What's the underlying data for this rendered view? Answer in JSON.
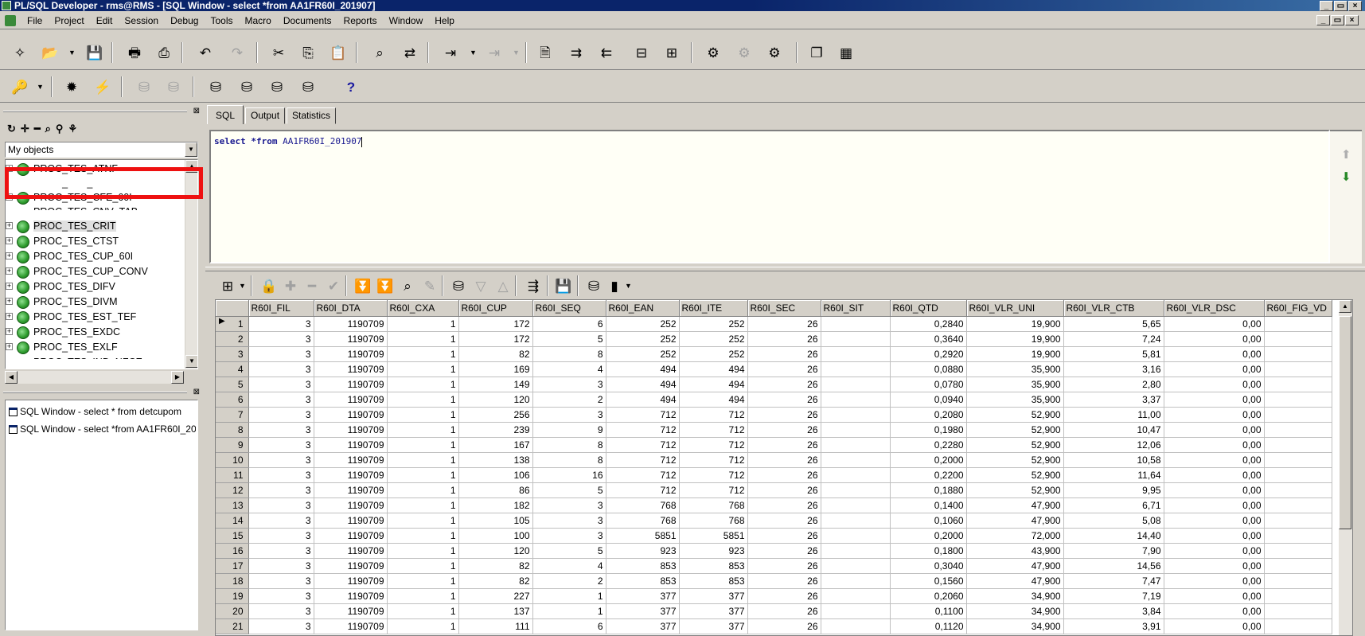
{
  "window": {
    "title": "PL/SQL Developer - rms@RMS - [SQL Window - select *from AA1FR60I_201907]",
    "controls": [
      "_",
      "▭",
      "×"
    ]
  },
  "menu": [
    "File",
    "Project",
    "Edit",
    "Session",
    "Debug",
    "Tools",
    "Macro",
    "Documents",
    "Reports",
    "Window",
    "Help"
  ],
  "toolbar_icons": [
    "new-icon",
    "open-icon",
    "save-icon",
    "print-icon",
    "print-preview-icon",
    "undo-icon",
    "redo-icon",
    "cut-icon",
    "copy-icon",
    "paste-icon",
    "find-icon",
    "find-replace-icon",
    "execute-icon",
    "break-icon",
    "describe-icon",
    "indent-icon",
    "unindent-icon",
    "comment-icon",
    "uncomment-icon",
    "compile-icon",
    "compile-dim-icon",
    "compile-all-icon",
    "window-list-icon",
    "layout-icon"
  ],
  "toolbar2_icons": [
    "key-icon",
    "gear-icon",
    "bolt-icon",
    "db-commit-icon",
    "db-rollback-icon",
    "user-icon",
    "csv-icon",
    "export-icon",
    "import-icon",
    "help-icon"
  ],
  "browser": {
    "selector_value": "My objects",
    "tree_items": [
      {
        "label": "PROC_TES_ATNF",
        "selected": false
      },
      {
        "label": "PROC_TES_CATE",
        "selected": false
      },
      {
        "label": "PROC_TES_CFE_60I",
        "selected": false
      },
      {
        "label": "PROC_TES_CNV_TAB",
        "selected": false
      },
      {
        "label": "PROC_TES_CRIT",
        "selected": true
      },
      {
        "label": "PROC_TES_CTST",
        "selected": false
      },
      {
        "label": "PROC_TES_CUP_60I",
        "selected": false
      },
      {
        "label": "PROC_TES_CUP_CONV",
        "selected": false
      },
      {
        "label": "PROC_TES_DIFV",
        "selected": false
      },
      {
        "label": "PROC_TES_DIVM",
        "selected": false
      },
      {
        "label": "PROC_TES_EST_TEF",
        "selected": false
      },
      {
        "label": "PROC_TES_EXDC",
        "selected": false
      },
      {
        "label": "PROC_TES_EXLF",
        "selected": false
      },
      {
        "label": "PROC_TES_IND_NFCE",
        "selected": false
      }
    ],
    "highlight_color": "#ee1111"
  },
  "window_list": [
    "SQL Window - select * from detcupom",
    "SQL Window - select *from AA1FR60I_201907"
  ],
  "tabs": [
    "SQL",
    "Output",
    "Statistics"
  ],
  "sql": {
    "keyword1": "select",
    "keyword2": "*from",
    "table": "AA1FR60I_201907"
  },
  "grid": {
    "columns": [
      "",
      "R60I_FIL",
      "R60I_DTA",
      "R60I_CXA",
      "R60I_CUP",
      "R60I_SEQ",
      "R60I_EAN",
      "R60I_ITE",
      "R60I_SEC",
      "R60I_SIT",
      "R60I_QTD",
      "R60I_VLR_UNI",
      "R60I_VLR_CTB",
      "R60I_VLR_DSC",
      "R60I_FIG_VD"
    ],
    "rows": [
      [
        "1",
        "3",
        "1190709",
        "1",
        "172",
        "6",
        "252",
        "252",
        "26",
        "",
        "0,2840",
        "19,900",
        "5,65",
        "0,00",
        ""
      ],
      [
        "2",
        "3",
        "1190709",
        "1",
        "172",
        "5",
        "252",
        "252",
        "26",
        "",
        "0,3640",
        "19,900",
        "7,24",
        "0,00",
        ""
      ],
      [
        "3",
        "3",
        "1190709",
        "1",
        "82",
        "8",
        "252",
        "252",
        "26",
        "",
        "0,2920",
        "19,900",
        "5,81",
        "0,00",
        ""
      ],
      [
        "4",
        "3",
        "1190709",
        "1",
        "169",
        "4",
        "494",
        "494",
        "26",
        "",
        "0,0880",
        "35,900",
        "3,16",
        "0,00",
        ""
      ],
      [
        "5",
        "3",
        "1190709",
        "1",
        "149",
        "3",
        "494",
        "494",
        "26",
        "",
        "0,0780",
        "35,900",
        "2,80",
        "0,00",
        ""
      ],
      [
        "6",
        "3",
        "1190709",
        "1",
        "120",
        "2",
        "494",
        "494",
        "26",
        "",
        "0,0940",
        "35,900",
        "3,37",
        "0,00",
        ""
      ],
      [
        "7",
        "3",
        "1190709",
        "1",
        "256",
        "3",
        "712",
        "712",
        "26",
        "",
        "0,2080",
        "52,900",
        "11,00",
        "0,00",
        ""
      ],
      [
        "8",
        "3",
        "1190709",
        "1",
        "239",
        "9",
        "712",
        "712",
        "26",
        "",
        "0,1980",
        "52,900",
        "10,47",
        "0,00",
        ""
      ],
      [
        "9",
        "3",
        "1190709",
        "1",
        "167",
        "8",
        "712",
        "712",
        "26",
        "",
        "0,2280",
        "52,900",
        "12,06",
        "0,00",
        ""
      ],
      [
        "10",
        "3",
        "1190709",
        "1",
        "138",
        "8",
        "712",
        "712",
        "26",
        "",
        "0,2000",
        "52,900",
        "10,58",
        "0,00",
        ""
      ],
      [
        "11",
        "3",
        "1190709",
        "1",
        "106",
        "16",
        "712",
        "712",
        "26",
        "",
        "0,2200",
        "52,900",
        "11,64",
        "0,00",
        ""
      ],
      [
        "12",
        "3",
        "1190709",
        "1",
        "86",
        "5",
        "712",
        "712",
        "26",
        "",
        "0,1880",
        "52,900",
        "9,95",
        "0,00",
        ""
      ],
      [
        "13",
        "3",
        "1190709",
        "1",
        "182",
        "3",
        "768",
        "768",
        "26",
        "",
        "0,1400",
        "47,900",
        "6,71",
        "0,00",
        ""
      ],
      [
        "14",
        "3",
        "1190709",
        "1",
        "105",
        "3",
        "768",
        "768",
        "26",
        "",
        "0,1060",
        "47,900",
        "5,08",
        "0,00",
        ""
      ],
      [
        "15",
        "3",
        "1190709",
        "1",
        "100",
        "3",
        "5851",
        "5851",
        "26",
        "",
        "0,2000",
        "72,000",
        "14,40",
        "0,00",
        ""
      ],
      [
        "16",
        "3",
        "1190709",
        "1",
        "120",
        "5",
        "923",
        "923",
        "26",
        "",
        "0,1800",
        "43,900",
        "7,90",
        "0,00",
        ""
      ],
      [
        "17",
        "3",
        "1190709",
        "1",
        "82",
        "4",
        "853",
        "853",
        "26",
        "",
        "0,3040",
        "47,900",
        "14,56",
        "0,00",
        ""
      ],
      [
        "18",
        "3",
        "1190709",
        "1",
        "82",
        "2",
        "853",
        "853",
        "26",
        "",
        "0,1560",
        "47,900",
        "7,47",
        "0,00",
        ""
      ],
      [
        "19",
        "3",
        "1190709",
        "1",
        "227",
        "1",
        "377",
        "377",
        "26",
        "",
        "0,2060",
        "34,900",
        "7,19",
        "0,00",
        ""
      ],
      [
        "20",
        "3",
        "1190709",
        "1",
        "137",
        "1",
        "377",
        "377",
        "26",
        "",
        "0,1100",
        "34,900",
        "3,84",
        "0,00",
        ""
      ],
      [
        "21",
        "3",
        "1190709",
        "1",
        "111",
        "6",
        "377",
        "377",
        "26",
        "",
        "0,1120",
        "34,900",
        "3,91",
        "0,00",
        ""
      ]
    ]
  }
}
